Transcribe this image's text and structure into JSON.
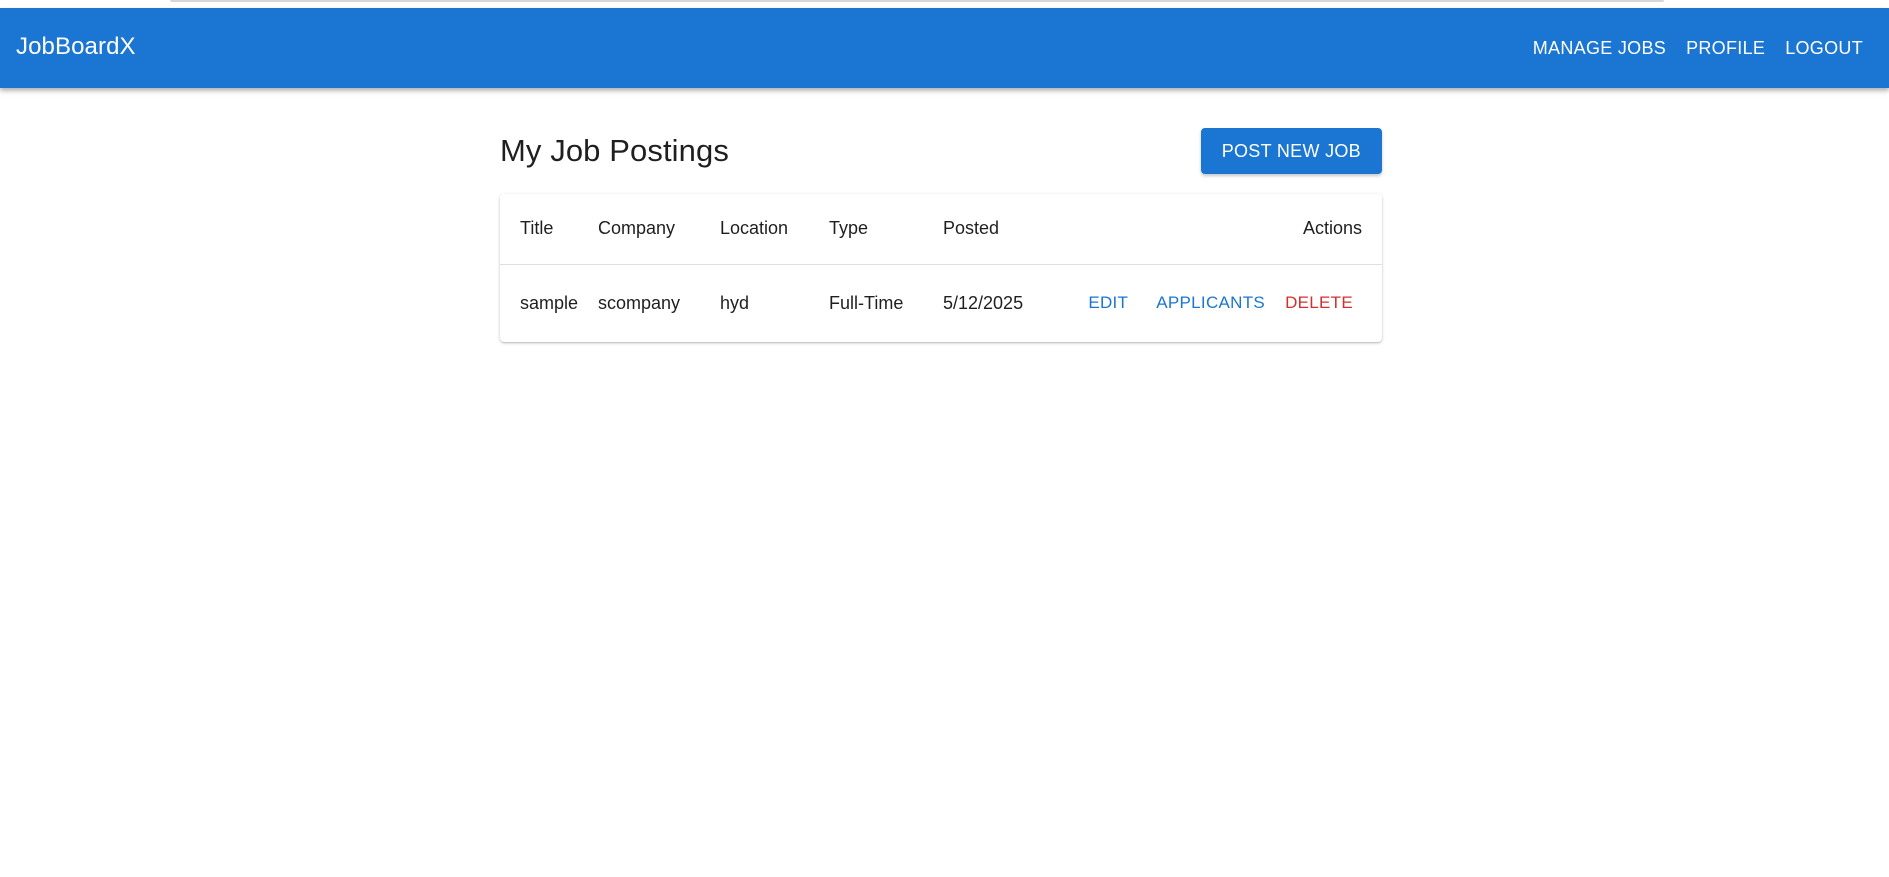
{
  "appbar": {
    "brand": "JobBoardX",
    "nav": {
      "manage_jobs": "MANAGE JOBS",
      "profile": "PROFILE",
      "logout": "LOGOUT"
    }
  },
  "main": {
    "title": "My Job Postings",
    "post_button": "POST NEW JOB"
  },
  "table": {
    "columns": {
      "title": "Title",
      "company": "Company",
      "location": "Location",
      "type": "Type",
      "posted": "Posted",
      "actions": "Actions"
    },
    "rows": [
      {
        "title": "sample",
        "company": "scompany",
        "location": "hyd",
        "type": "Full-Time",
        "posted": "5/12/2025",
        "actions": {
          "edit": "EDIT",
          "applicants": "APPLICANTS",
          "delete": "DELETE"
        }
      }
    ]
  },
  "colors": {
    "primary": "#1a76d2",
    "danger": "#d32f2f"
  }
}
